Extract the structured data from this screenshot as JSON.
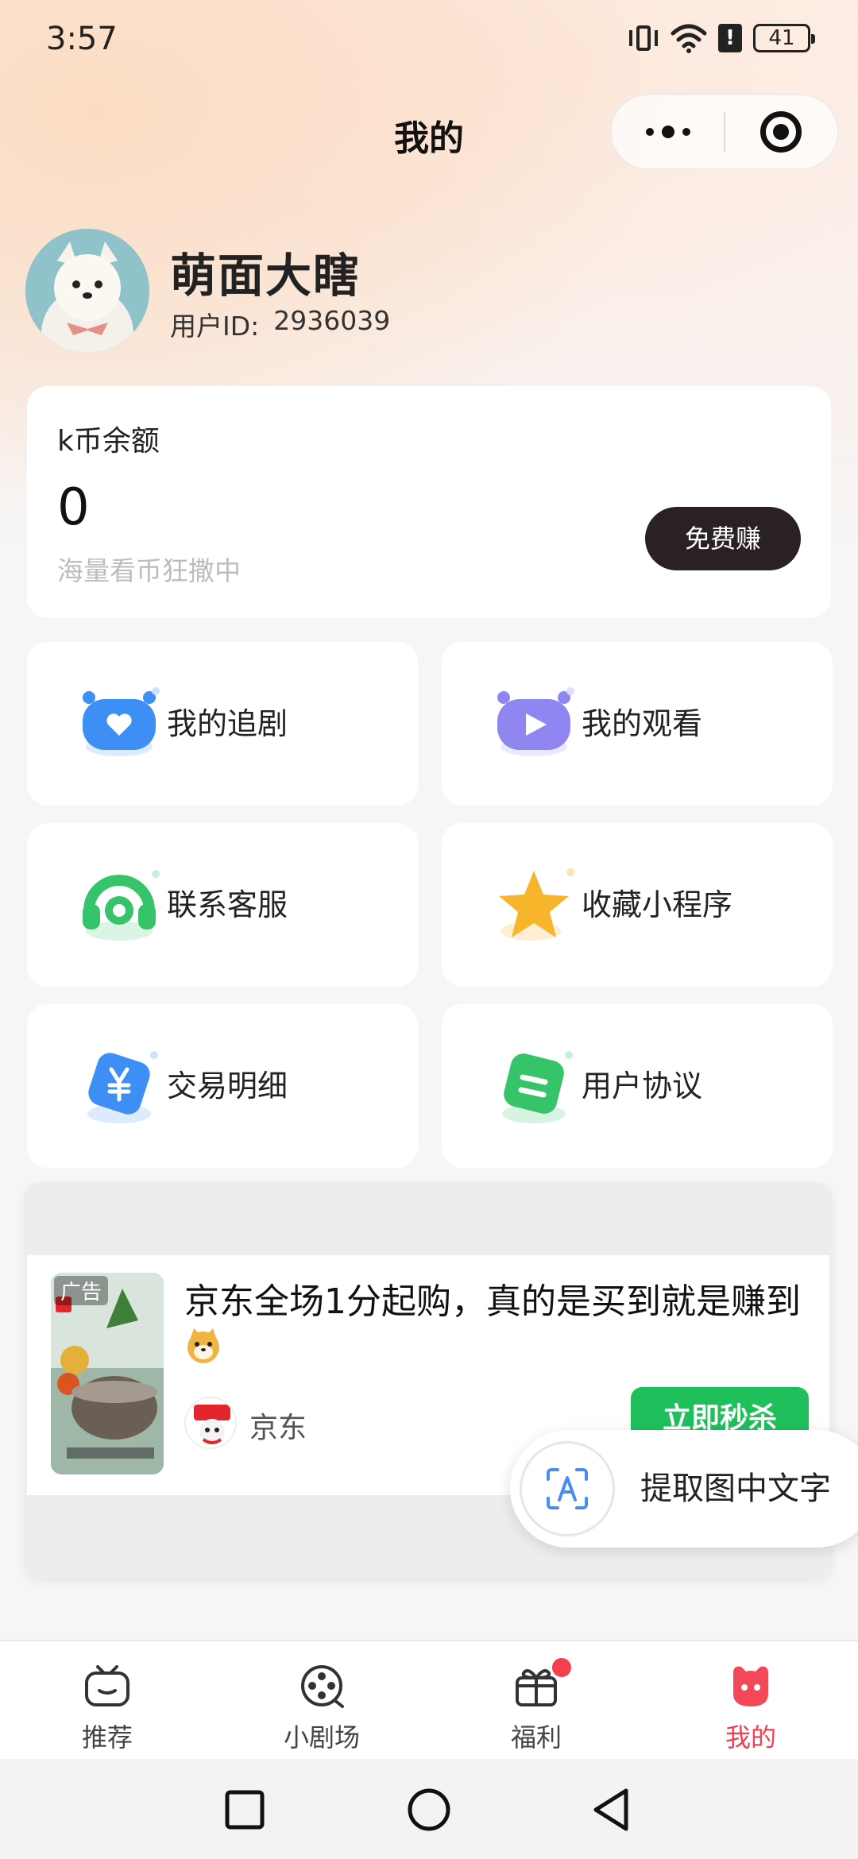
{
  "status_bar": {
    "time": "3:57",
    "battery": "41",
    "alert_glyph": "!"
  },
  "header": {
    "title": "我的"
  },
  "profile": {
    "username": "萌面大瞎",
    "id_label": "用户ID:",
    "id_value": "2936039"
  },
  "balance": {
    "label": "k币余额",
    "value": "0",
    "tip": "海量看币狂撒中",
    "earn_button": "免费赚"
  },
  "menu": {
    "items": [
      {
        "label": "我的追剧",
        "icon": "heart-tv-icon",
        "color": "#3d8ef5"
      },
      {
        "label": "我的观看",
        "icon": "play-tv-icon",
        "color": "#8f86f2"
      },
      {
        "label": "联系客服",
        "icon": "headset-icon",
        "color": "#35c46a"
      },
      {
        "label": "收藏小程序",
        "icon": "star-icon",
        "color": "#f7a826"
      },
      {
        "label": "交易明细",
        "icon": "yen-icon",
        "color": "#3d8ef5"
      },
      {
        "label": "用户协议",
        "icon": "document-icon",
        "color": "#35c46a"
      }
    ]
  },
  "ad": {
    "tag": "广告",
    "title": "京东全场1分起购，真的是买到就是赚到",
    "brand": "京东",
    "cta": "立即秒杀"
  },
  "ocr": {
    "label": "提取图中文字"
  },
  "tabbar": {
    "items": [
      {
        "label": "推荐",
        "icon": "tv-icon",
        "active": false
      },
      {
        "label": "小剧场",
        "icon": "film-reel-icon",
        "active": false
      },
      {
        "label": "福利",
        "icon": "gift-icon",
        "active": false,
        "badge": true
      },
      {
        "label": "我的",
        "icon": "profile-face-icon",
        "active": true
      }
    ],
    "active_color": "#f03d4f"
  }
}
